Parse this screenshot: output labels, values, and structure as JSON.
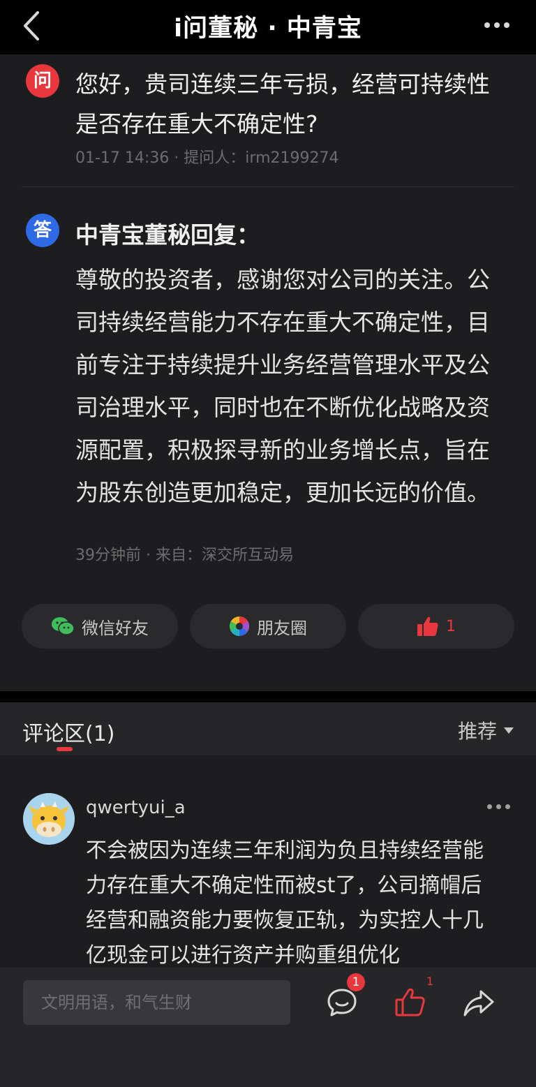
{
  "header": {
    "title": "i问董秘 · 中青宝",
    "back_icon": "chevron-left-icon",
    "more_icon": "more-horizontal-icon"
  },
  "question": {
    "badge": "问",
    "text": "您好，贵司连续三年亏损，经营可持续性是否存在重大不确定性?",
    "meta": "01-17 14:36 · 提问人：irm2199274"
  },
  "answer": {
    "badge": "答",
    "title": "中青宝董秘回复：",
    "text": "尊敬的投资者，感谢您对公司的关注。公司持续经营能力不存在重大不确定性，目前专注于持续提升业务经营管理水平及公司治理水平，同时也在不断优化战略及资源配置，积极探寻新的业务增长点，旨在为股东创造更加稳定，更加长远的价值。",
    "meta": "39分钟前 · 来自：深交所互动易"
  },
  "share": {
    "wechat_label": "微信好友",
    "moments_label": "朋友圈",
    "like_count": "1"
  },
  "comments_section": {
    "tab_label": "评论区(1)",
    "sort_label": "推荐",
    "items": [
      {
        "user": "qwertyui_a",
        "text": "不会被因为连续三年利润为负且持续经营能力存在重大不确定性而被st了，公司摘帽后经营和融资能力要恢复正轨，为实控人十几亿现金可以进行资产并购重组优化"
      }
    ]
  },
  "bottom_bar": {
    "input_placeholder": "文明用语，和气生财",
    "comment_badge": "1",
    "like_count": "1"
  },
  "colors": {
    "accent_red": "#e8383d",
    "answer_blue": "#2f6ae6",
    "background": "#1d1d1f"
  }
}
